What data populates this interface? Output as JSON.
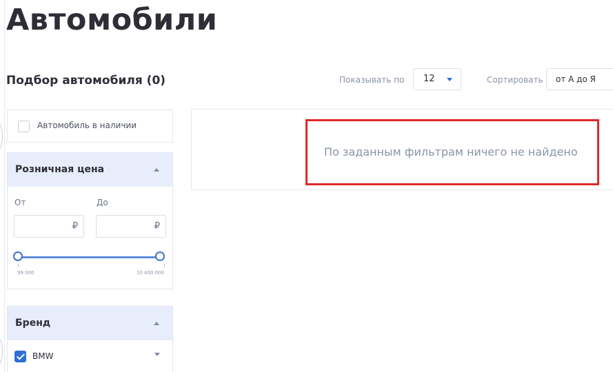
{
  "page": {
    "title": "Автомобили"
  },
  "filters": {
    "heading": "Подбор автомобиля (0)",
    "in_stock_label": "Автомобиль в наличии",
    "price": {
      "title": "Розничная цена",
      "from_label": "От",
      "to_label": "До",
      "currency": "₽",
      "scale_min": "99 000",
      "scale_max": "10 400 000",
      "range_low_fraction": 0,
      "range_high_fraction": 1
    },
    "brand": {
      "title": "Бренд",
      "items": [
        {
          "label": "BMW",
          "checked": true
        }
      ]
    }
  },
  "toolbar": {
    "show_label": "Показывать по",
    "per_page": "12",
    "sort_label": "Сортировать",
    "sort_value": "от А до Я"
  },
  "results": {
    "empty_message": "По заданным фильтрам ничего не найдено"
  },
  "colors": {
    "accent": "#2f6fd6",
    "panel_header_bg": "#e8edfb",
    "highlight_border": "#e02828"
  }
}
